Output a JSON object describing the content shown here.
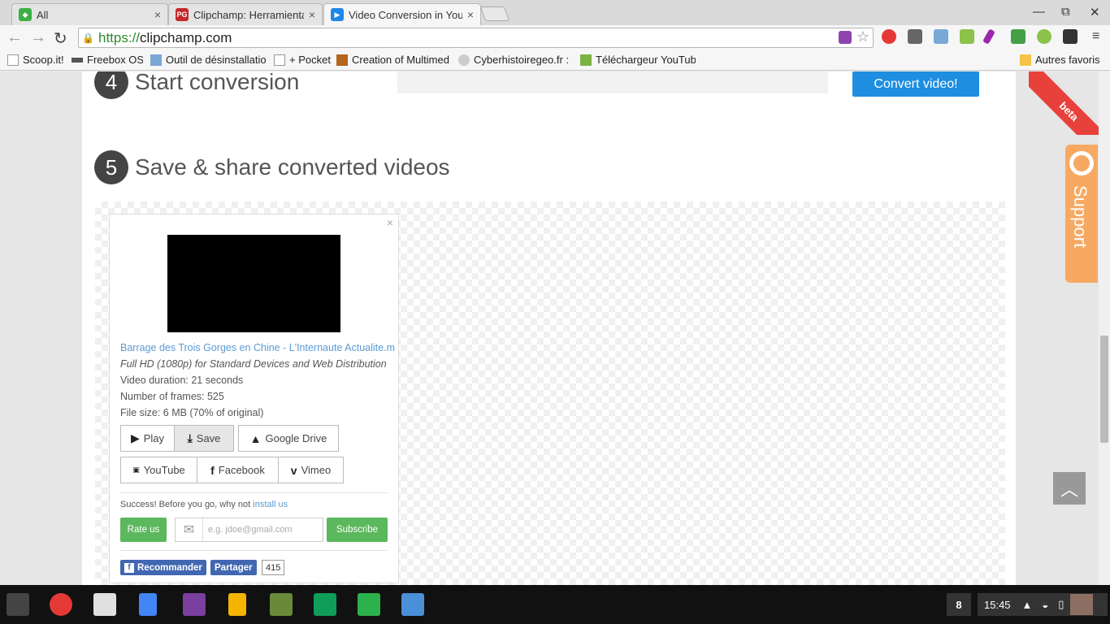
{
  "tabs": [
    {
      "title": "All",
      "favicon_color": "#3cb043",
      "close": "×"
    },
    {
      "title": "Clipchamp: Herramienta",
      "favicon_color": "#c62828",
      "close": "×"
    },
    {
      "title": "Video Conversion in Your",
      "favicon_color": "#1e88e5",
      "close": "×",
      "active": true
    }
  ],
  "window": {
    "minimize": "—",
    "maximize": "⧉",
    "close": "✕"
  },
  "toolbar": {
    "back": "←",
    "forward": "→",
    "reload": "↻",
    "url_scheme": "https://",
    "url_host": "clipchamp.com"
  },
  "bookmarks": [
    {
      "label": "Scoop.it!"
    },
    {
      "label": "Freebox OS"
    },
    {
      "label": "Outil de désinstallatio"
    },
    {
      "label": "+ Pocket"
    },
    {
      "label": "Creation of Multimed"
    },
    {
      "label": "Cyberhistoiregeo.fr :"
    },
    {
      "label": "Téléchargeur YouTub"
    },
    {
      "label": "Autres favoris"
    }
  ],
  "steps": {
    "start": {
      "num": "4",
      "label": "Start conversion"
    },
    "save": {
      "num": "5",
      "label": "Save & share converted videos"
    }
  },
  "convert_label": "Convert video!",
  "result": {
    "close": "×",
    "filename": "Barrage des Trois Gorges en Chine - L'Internaute Actualite.m",
    "quality": "Full HD (1080p) for Standard Devices and Web Distribution",
    "duration": "Video duration: 21 seconds",
    "frames": "Number of frames: 525",
    "filesize": "File size: 6 MB (70% of original)",
    "buttons": {
      "play": "Play",
      "save": "Save",
      "gdrive": "Google Drive",
      "youtube": "YouTube",
      "facebook": "Facebook",
      "vimeo": "Vimeo"
    },
    "success_text": "Success! Before you go, why not",
    "install_link": "install us",
    "rate": "Rate us",
    "email_placeholder": "e.g. jdoe@gmail.com",
    "subscribe": "Subscribe",
    "fb_recommend": "Recommander",
    "fb_share": "Partager",
    "fb_count": "415"
  },
  "beta": "beta",
  "support": "Support",
  "tray": {
    "badge": "8",
    "time": "15:45"
  }
}
